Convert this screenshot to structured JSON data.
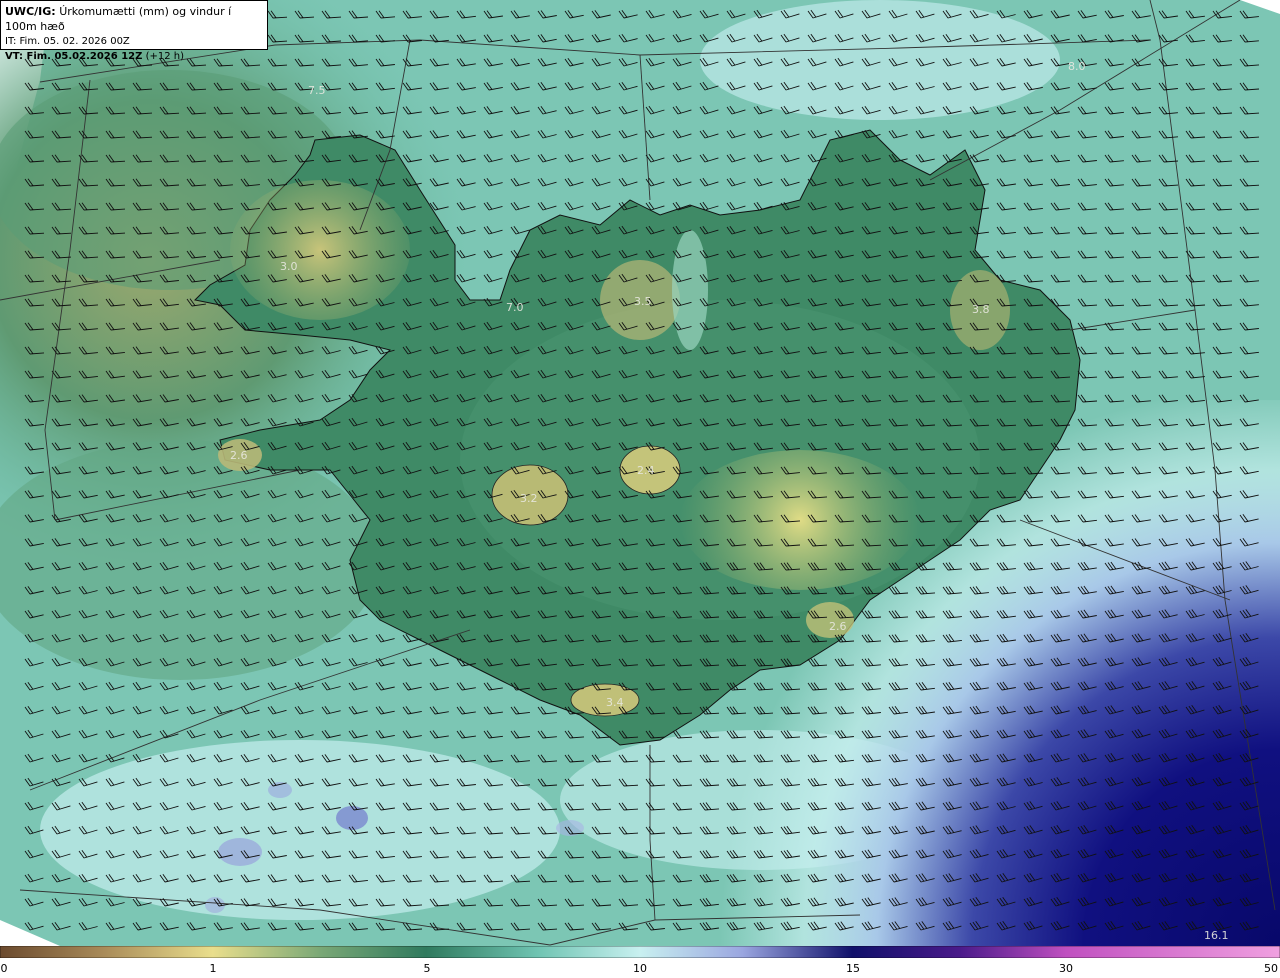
{
  "header": {
    "prefix": "UWC/IG:",
    "title": "Úrkomumætti (mm) og vindur í 100m hæð",
    "it_label": "IT:",
    "it_value": "Fim. 05. 02. 2026 00Z",
    "vt_label": "VT: Fim. 05.02.2026 12Z",
    "vt_suffix": "(+12 h)"
  },
  "map_values": [
    "7.5",
    "8.0",
    "3.0",
    "7.0",
    "3.5",
    "3.8",
    "2.6",
    "3.2",
    "2.4",
    "2.6",
    "3.4",
    "16.1"
  ],
  "colorbar": {
    "ticks": [
      "0",
      "1",
      "5",
      "10",
      "15",
      "30",
      "50"
    ],
    "colors": [
      "#6b4a2e",
      "#b99a5c",
      "#e9de8c",
      "#5f9a72",
      "#2f7a5e",
      "#6fc4b2",
      "#c8f0f0",
      "#9aa6e0",
      "#2a2a9a",
      "#10106a",
      "#c050c0",
      "#f0a0e0"
    ]
  },
  "colors": {
    "land": "#4f9a74",
    "ocean": "#7cc6b4",
    "highland": "#c8c87a",
    "heavy_precip": "#0a0a6e"
  }
}
